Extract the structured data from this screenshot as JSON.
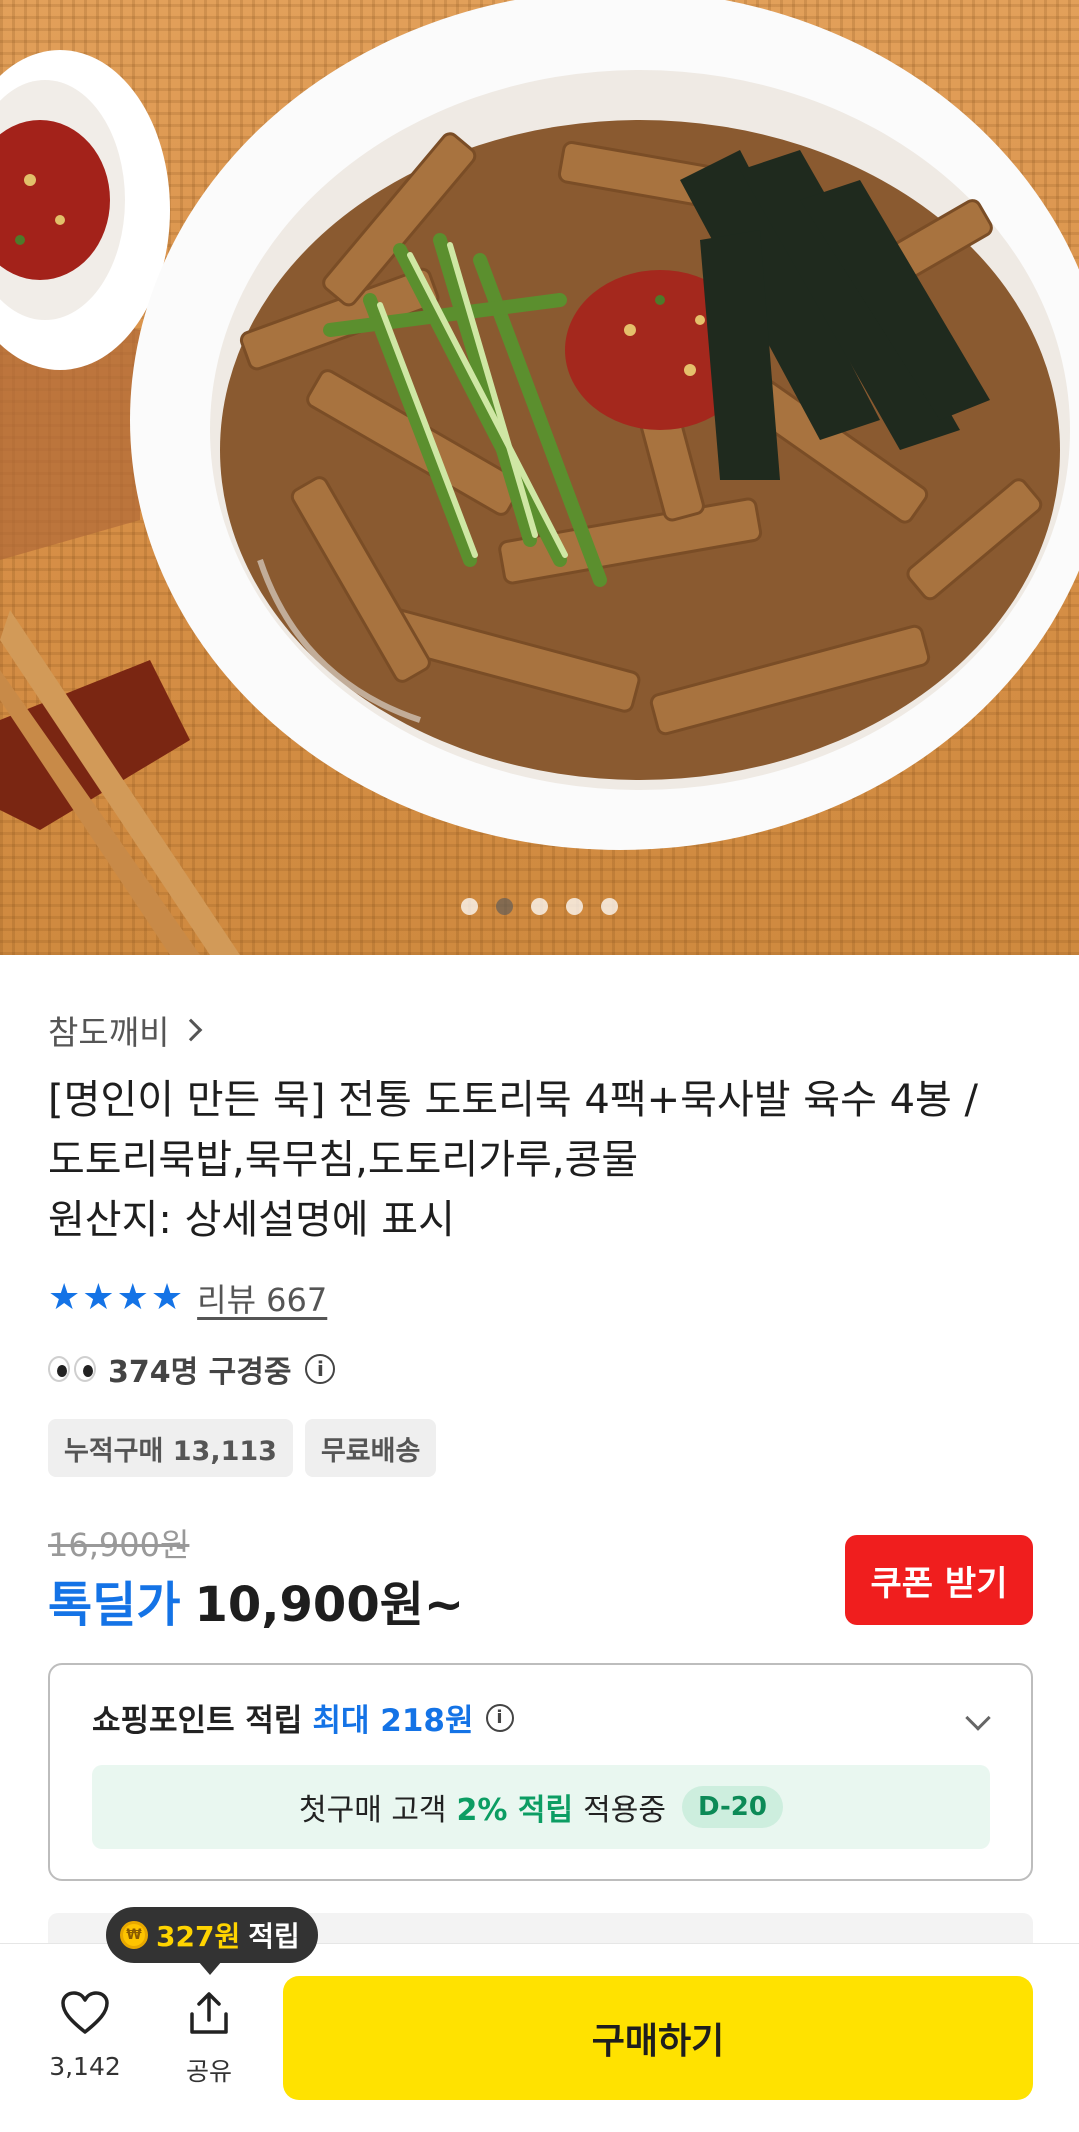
{
  "hero": {
    "image_description": "",
    "carousel": {
      "total": 5,
      "active_index": 1
    }
  },
  "product": {
    "seller": "참도깨비",
    "title_lines": [
      "[명인이 만든 묵] 전통 도토리묵 4팩+묵사발 육수 4봉 /",
      "도토리묵밥,묵무침,도토리가루,콩물",
      "원산지: 상세설명에 표시"
    ],
    "rating_stars": 4.5,
    "review_label": "리뷰 667",
    "viewers_label": "374명 구경중",
    "tags": [
      "누적구매 13,113",
      "무료배송"
    ],
    "original_price": "16,900원",
    "deal_label": "톡딜가",
    "deal_price": "10,900원~",
    "coupon_button": "쿠폰 받기"
  },
  "points": {
    "title": "쇼핑포인트 적립",
    "max_label": "최대 218원",
    "banner_prefix": "첫구매 고객",
    "banner_pct": "2% 적립",
    "banner_suffix": "적용중",
    "dday": "D-20"
  },
  "bottom_bar": {
    "reward_amount": "327원",
    "reward_suffix": "적립",
    "like_count": "3,142",
    "share_label": "공유",
    "buy_button": "구매하기"
  },
  "colors": {
    "accent_blue": "#1473e6",
    "coupon_red": "#f01e1e",
    "buy_yellow": "#ffe200",
    "point_green": "#0c9d63"
  }
}
